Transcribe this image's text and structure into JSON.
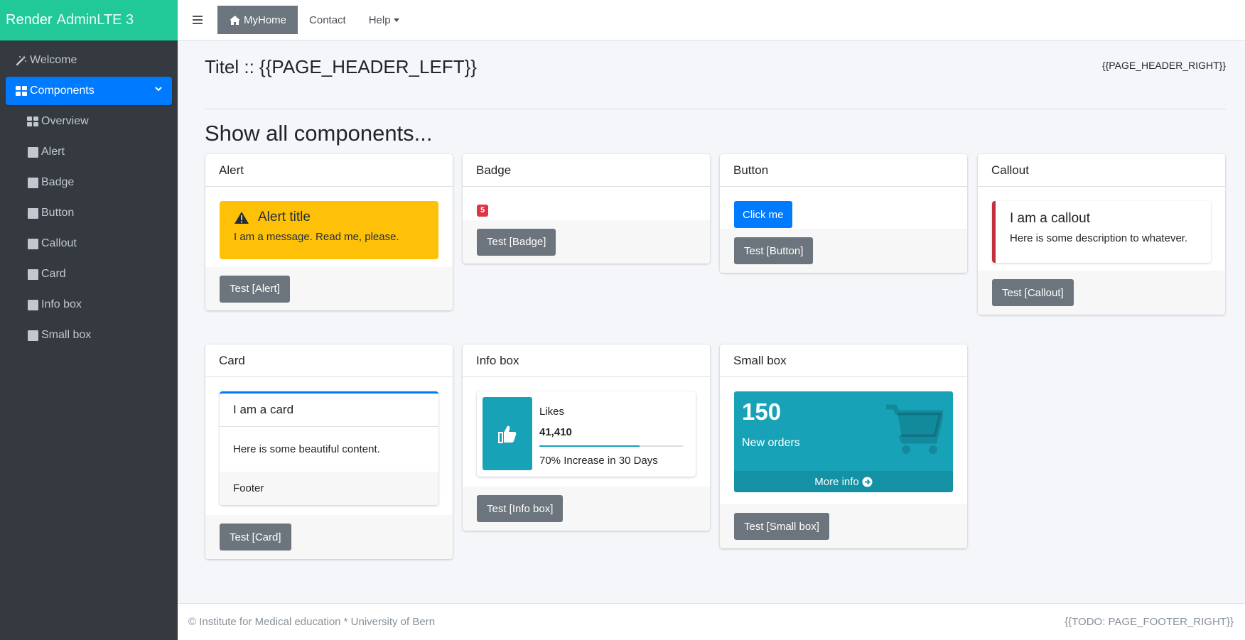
{
  "brand": {
    "name_bold": "Render",
    "name_light": "AdminLTE 3"
  },
  "sidebar": {
    "welcome": "Welcome",
    "components": "Components",
    "items": [
      {
        "label": "Overview",
        "icon": "th-large-icon"
      },
      {
        "label": "Alert",
        "icon": "square-icon"
      },
      {
        "label": "Badge",
        "icon": "square-icon"
      },
      {
        "label": "Button",
        "icon": "square-icon"
      },
      {
        "label": "Callout",
        "icon": "square-icon"
      },
      {
        "label": "Card",
        "icon": "square-icon"
      },
      {
        "label": "Info box",
        "icon": "square-icon"
      },
      {
        "label": "Small box",
        "icon": "square-icon"
      }
    ]
  },
  "topnav": {
    "home": "MyHome",
    "contact": "Contact",
    "help": "Help"
  },
  "page": {
    "title": "Titel :: {{PAGE_HEADER_LEFT}}",
    "right": "{{PAGE_HEADER_RIGHT}}",
    "section": "Show all components..."
  },
  "cards": {
    "alert": {
      "header": "Alert",
      "title": "Alert title",
      "message": "I am a message. Read me, please.",
      "button": "Test [Alert]"
    },
    "badge": {
      "header": "Badge",
      "badge": "5",
      "button": "Test [Badge]"
    },
    "button": {
      "header": "Button",
      "primary": "Click me",
      "button": "Test [Button]"
    },
    "callout": {
      "header": "Callout",
      "title": "I am a callout",
      "text": "Here is some description to whatever.",
      "button": "Test [Callout]"
    },
    "card": {
      "header": "Card",
      "inner_title": "I am a card",
      "inner_body": "Here is some beautiful content.",
      "inner_footer": "Footer",
      "button": "Test [Card]"
    },
    "infobox": {
      "header": "Info box",
      "text": "Likes",
      "number": "41,410",
      "progress": 70,
      "description": "70% Increase in 30 Days",
      "button": "Test [Info box]"
    },
    "smallbox": {
      "header": "Small box",
      "number": "150",
      "label": "New orders",
      "more": "More info",
      "button": "Test [Small box]"
    }
  },
  "footer": {
    "left": "© Institute for Medical education * University of Bern",
    "right": "{{TODO: PAGE_FOOTER_RIGHT}}"
  },
  "colors": {
    "brand": "#20c997",
    "primary": "#007bff",
    "warning": "#ffc107",
    "danger": "#dc3545",
    "info": "#17a2b8",
    "secondary": "#6c757d"
  }
}
